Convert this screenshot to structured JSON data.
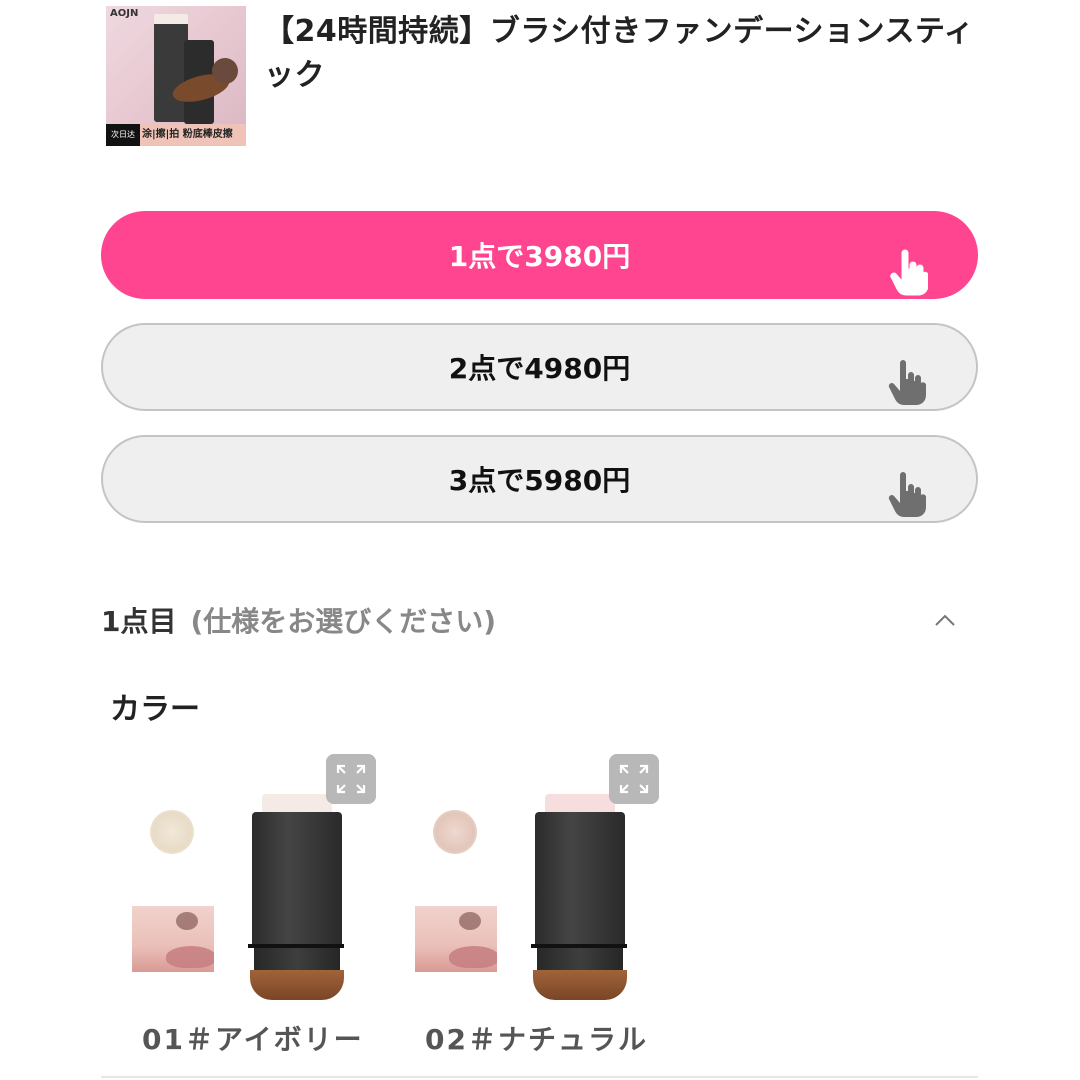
{
  "product": {
    "thumbnail_icon": "product-photo",
    "thumbnail_brand": "AOJN",
    "thumbnail_banner_tag": "次日达",
    "thumbnail_banner": "涂|擦|拍 粉底棒皮擦",
    "title": "【24時間持続】ブラシ付きファンデーションスティック"
  },
  "bundles": [
    {
      "label": "1点で3980円",
      "selected": true
    },
    {
      "label": "2点で4980円",
      "selected": false
    },
    {
      "label": "3点で5980円",
      "selected": false
    }
  ],
  "section": {
    "item_label": "1点目",
    "hint": "(仕様をお選びください)",
    "toggle_icon": "chevron-up-icon"
  },
  "color_group": {
    "label": "カラー",
    "options": [
      {
        "caption": "01＃アイボリー",
        "powder_color": "#efe4d4",
        "cap_color": "#f4ebe6"
      },
      {
        "caption": "02＃ナチュラル",
        "powder_color": "#ead7cc",
        "cap_color": "#f6dede"
      }
    ]
  },
  "colors": {
    "accent": "#ff4490",
    "inactive_bg": "#efefef",
    "inactive_border": "#c4c4c4"
  }
}
